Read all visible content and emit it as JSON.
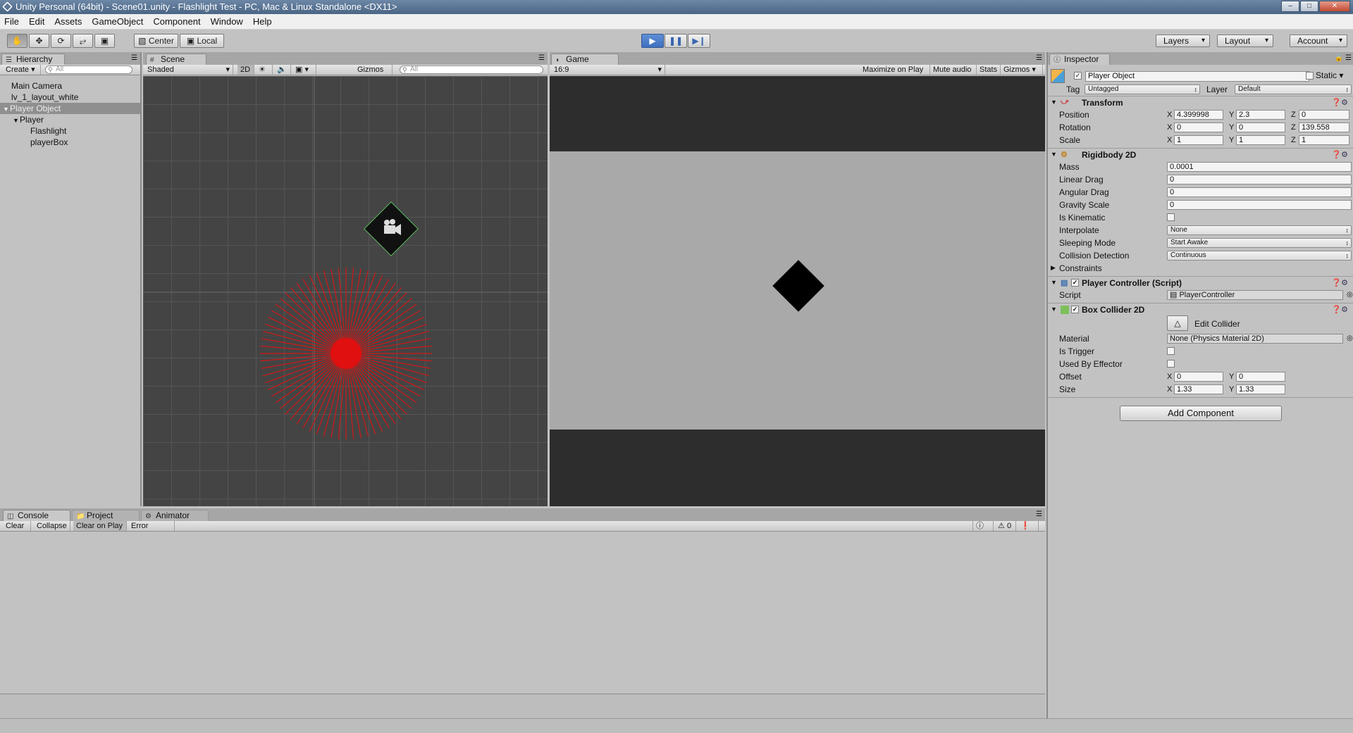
{
  "window": {
    "title": "Unity Personal (64bit) - Scene01.unity - Flashlight Test - PC, Mac & Linux Standalone <DX11>"
  },
  "menu": [
    "File",
    "Edit",
    "Assets",
    "GameObject",
    "Component",
    "Window",
    "Help"
  ],
  "toolbar": {
    "pivot": "Center",
    "space": "Local",
    "layers": "Layers",
    "layout": "Layout",
    "account": "Account"
  },
  "hierarchy": {
    "tab": "Hierarchy",
    "create": "Create",
    "search_placeholder": "All",
    "items": [
      {
        "label": "Main Camera",
        "depth": 0
      },
      {
        "label": "lv_1_layout_white",
        "depth": 0
      },
      {
        "label": "Player Object",
        "depth": 0,
        "expanded": true,
        "selected": true
      },
      {
        "label": "Player",
        "depth": 1,
        "expanded": true
      },
      {
        "label": "Flashlight",
        "depth": 2
      },
      {
        "label": "playerBox",
        "depth": 2
      }
    ]
  },
  "scene": {
    "tab": "Scene",
    "shading": "Shaded",
    "mode2d": "2D",
    "gizmos": "Gizmos",
    "search_placeholder": "All"
  },
  "game": {
    "tab": "Game",
    "aspect": "16:9",
    "maximize": "Maximize on Play",
    "mute": "Mute audio",
    "stats": "Stats",
    "gizmos": "Gizmos"
  },
  "console": {
    "tabs": [
      "Console",
      "Project",
      "Animator"
    ],
    "buttons": [
      "Clear",
      "Collapse",
      "Clear on Play",
      "Error Pause"
    ],
    "counts": {
      "info": "0",
      "warn": "0",
      "error": "0"
    }
  },
  "inspector": {
    "tab": "Inspector",
    "object_name": "Player Object",
    "static": "Static",
    "tag_label": "Tag",
    "tag": "Untagged",
    "layer_label": "Layer",
    "layer": "Default",
    "transform": {
      "title": "Transform",
      "position": {
        "label": "Position",
        "x": "4.399998",
        "y": "2.3",
        "z": "0"
      },
      "rotation": {
        "label": "Rotation",
        "x": "0",
        "y": "0",
        "z": "139.558"
      },
      "scale": {
        "label": "Scale",
        "x": "1",
        "y": "1",
        "z": "1"
      }
    },
    "rigidbody": {
      "title": "Rigidbody 2D",
      "mass_label": "Mass",
      "mass": "0.0001",
      "linear_drag_label": "Linear Drag",
      "linear_drag": "0",
      "angular_drag_label": "Angular Drag",
      "angular_drag": "0",
      "gravity_label": "Gravity Scale",
      "gravity": "0",
      "kinematic_label": "Is Kinematic",
      "interpolate_label": "Interpolate",
      "interpolate": "None",
      "sleeping_label": "Sleeping Mode",
      "sleeping": "Start Awake",
      "collision_label": "Collision Detection",
      "collision": "Continuous",
      "constraints_label": "Constraints"
    },
    "controller": {
      "title": "Player Controller (Script)",
      "script_label": "Script",
      "script": "PlayerController"
    },
    "collider": {
      "title": "Box Collider 2D",
      "edit": "Edit Collider",
      "material_label": "Material",
      "material": "None (Physics Material 2D)",
      "trigger_label": "Is Trigger",
      "effector_label": "Used By Effector",
      "offset_label": "Offset",
      "offset_x": "0",
      "offset_y": "0",
      "size_label": "Size",
      "size_x": "1.33",
      "size_y": "1.33"
    },
    "add_component": "Add Component",
    "axes": {
      "x": "X",
      "y": "Y",
      "z": "Z"
    }
  }
}
